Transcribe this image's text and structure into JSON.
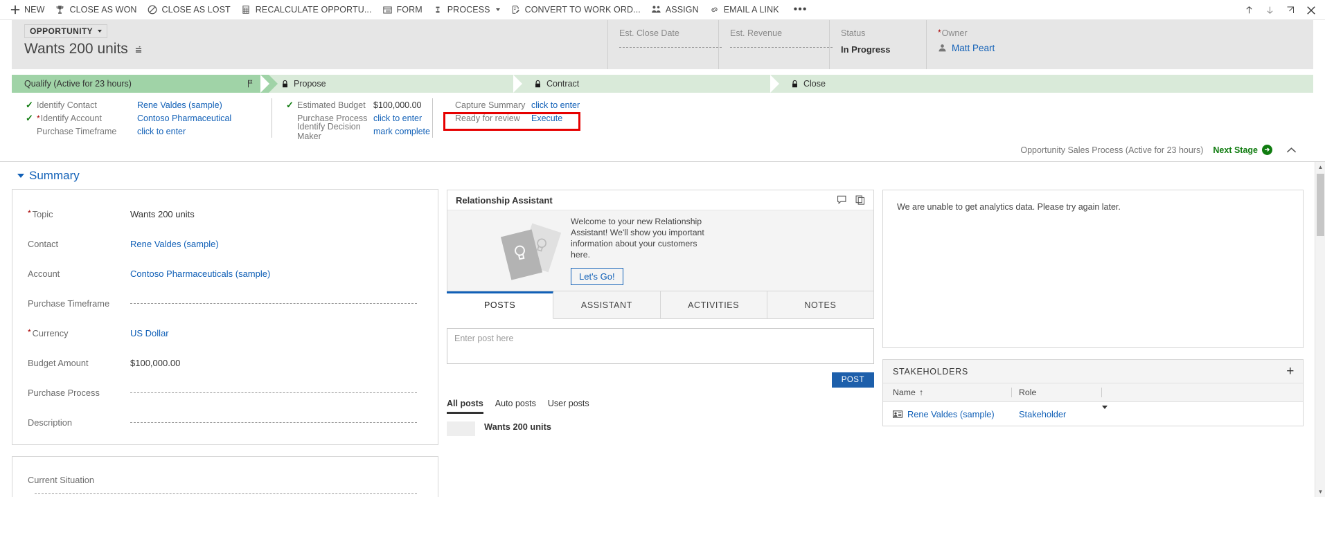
{
  "commandbar": {
    "items": [
      {
        "label": "NEW",
        "icon": "plus-icon"
      },
      {
        "label": "CLOSE AS WON",
        "icon": "trophy-icon"
      },
      {
        "label": "CLOSE AS LOST",
        "icon": "block-icon"
      },
      {
        "label": "RECALCULATE OPPORTU...",
        "icon": "calculator-icon"
      },
      {
        "label": "FORM",
        "icon": "form-icon"
      },
      {
        "label": "PROCESS",
        "icon": "process-icon",
        "has_caret": true
      },
      {
        "label": "CONVERT TO WORK ORD...",
        "icon": "convert-icon"
      },
      {
        "label": "ASSIGN",
        "icon": "assign-icon"
      },
      {
        "label": "EMAIL A LINK",
        "icon": "link-icon"
      }
    ],
    "overflow_label": "•••",
    "right_icons": [
      "arrow-up-icon",
      "arrow-down-icon",
      "popout-icon",
      "close-icon"
    ]
  },
  "header": {
    "entity_type": "OPPORTUNITY",
    "record_title": "Wants 200 units",
    "fields": [
      {
        "label": "Est. Close Date",
        "value": "",
        "required": false
      },
      {
        "label": "Est. Revenue",
        "value": "",
        "required": false
      },
      {
        "label": "Status",
        "value": "In Progress",
        "required": false
      },
      {
        "label": "Owner",
        "value": "Matt Peart",
        "required": true
      }
    ]
  },
  "process": {
    "stages": [
      {
        "label": "Qualify (Active for 23 hours)",
        "state": "active",
        "locked": false
      },
      {
        "label": "Propose",
        "state": "upcoming",
        "locked": true
      },
      {
        "label": "Contract",
        "state": "upcoming",
        "locked": true
      },
      {
        "label": "Close",
        "state": "upcoming",
        "locked": true
      }
    ],
    "step_columns": [
      {
        "steps": [
          {
            "name": "Identify Contact",
            "value": "Rene Valdes (sample)",
            "complete": true,
            "required": false,
            "link": true
          },
          {
            "name": "Identify Account",
            "value": "Contoso Pharmaceutical",
            "complete": true,
            "required": true,
            "link": true
          },
          {
            "name": "Purchase Timeframe",
            "value": "click to enter",
            "complete": false,
            "required": false,
            "link": true
          }
        ]
      },
      {
        "steps": [
          {
            "name": "Estimated Budget",
            "value": "$100,000.00",
            "complete": true,
            "required": false,
            "link": false
          },
          {
            "name": "Purchase Process",
            "value": "click to enter",
            "complete": false,
            "required": false,
            "link": true
          },
          {
            "name": "Identify Decision Maker",
            "value": "mark complete",
            "complete": false,
            "required": false,
            "link": true
          }
        ]
      },
      {
        "steps": [
          {
            "name": "Capture Summary",
            "value": "click to enter",
            "complete": false,
            "required": false,
            "link": true
          },
          {
            "name": "Ready for review",
            "value": "Execute",
            "complete": false,
            "required": false,
            "link": true,
            "highlighted": true
          }
        ]
      }
    ],
    "footer_text": "Opportunity Sales Process (Active for 23 hours)",
    "next_stage_label": "Next Stage"
  },
  "summary": {
    "section_title": "Summary",
    "fields": [
      {
        "label": "Topic",
        "value": "Wants 200 units",
        "required": true,
        "link": false,
        "empty": false
      },
      {
        "label": "Contact",
        "value": "Rene Valdes (sample)",
        "required": false,
        "link": true,
        "empty": false
      },
      {
        "label": "Account",
        "value": "Contoso Pharmaceuticals (sample)",
        "required": false,
        "link": true,
        "empty": false
      },
      {
        "label": "Purchase Timeframe",
        "value": "",
        "required": false,
        "link": false,
        "empty": true
      },
      {
        "label": "Currency",
        "value": "US Dollar",
        "required": true,
        "link": true,
        "empty": false
      },
      {
        "label": "Budget Amount",
        "value": "$100,000.00",
        "required": false,
        "link": false,
        "empty": false
      },
      {
        "label": "Purchase Process",
        "value": "",
        "required": false,
        "link": false,
        "empty": true
      },
      {
        "label": "Description",
        "value": "",
        "required": false,
        "link": false,
        "empty": true
      }
    ],
    "current_situation_label": "Current Situation"
  },
  "relationship_assistant": {
    "title": "Relationship Assistant",
    "welcome_text": "Welcome to your new Relationship Assistant! We'll show you important information about your customers here.",
    "cta_label": "Let's Go!"
  },
  "social_pane": {
    "tabs": [
      {
        "label": "POSTS",
        "active": true
      },
      {
        "label": "ASSISTANT",
        "active": false
      },
      {
        "label": "ACTIVITIES",
        "active": false
      },
      {
        "label": "NOTES",
        "active": false
      }
    ],
    "post_placeholder": "Enter post here",
    "post_button": "POST",
    "filters": [
      {
        "label": "All posts",
        "active": true
      },
      {
        "label": "Auto posts",
        "active": false
      },
      {
        "label": "User posts",
        "active": false
      }
    ],
    "feed_items": [
      {
        "title": "Wants 200 units"
      }
    ]
  },
  "analytics": {
    "message": "We are unable to get analytics data. Please try again later."
  },
  "stakeholders": {
    "title": "STAKEHOLDERS",
    "add_label": "+",
    "columns": [
      "Name",
      "Role"
    ],
    "sort_column": "Name",
    "sort_direction": "↑",
    "rows": [
      {
        "name": "Rene Valdes (sample)",
        "role": "Stakeholder"
      }
    ]
  },
  "colors": {
    "accent_blue": "#1160b7",
    "stage_active_green": "#a0d3a7",
    "stage_upcoming_green": "#d9ead9",
    "highlight_red": "#e60000",
    "success_green": "#107c10",
    "post_button_blue": "#1d5fab"
  }
}
